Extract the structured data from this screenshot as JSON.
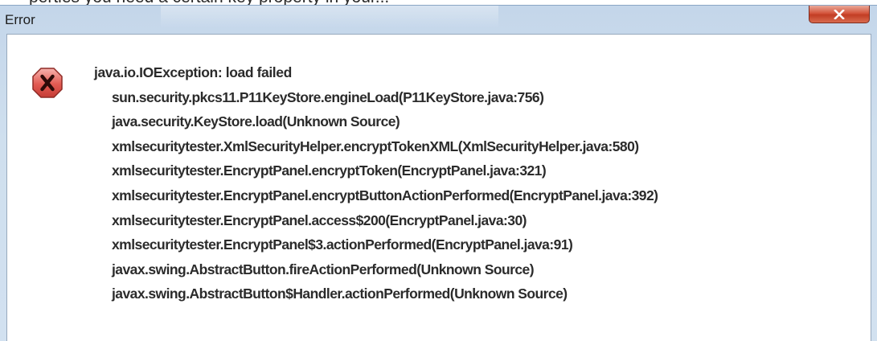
{
  "top_strip_text": "perties you need a certain key property in your...",
  "dialog": {
    "title": "Error",
    "close_label": "X",
    "icon": "error-x-icon",
    "exception_message": "java.io.IOException: load failed",
    "stack_frames": [
      "sun.security.pkcs11.P11KeyStore.engineLoad(P11KeyStore.java:756)",
      "java.security.KeyStore.load(Unknown Source)",
      "xmlsecuritytester.XmlSecurityHelper.encryptTokenXML(XmlSecurityHelper.java:580)",
      "xmlsecuritytester.EncryptPanel.encryptToken(EncryptPanel.java:321)",
      "xmlsecuritytester.EncryptPanel.encryptButtonActionPerformed(EncryptPanel.java:392)",
      "xmlsecuritytester.EncryptPanel.access$200(EncryptPanel.java:30)",
      "xmlsecuritytester.EncryptPanel$3.actionPerformed(EncryptPanel.java:91)",
      "javax.swing.AbstractButton.fireActionPerformed(Unknown Source)",
      "javax.swing.AbstractButton$Handler.actionPerformed(Unknown Source)"
    ]
  },
  "colors": {
    "icon_fill": "#e0554f",
    "icon_glyph": "#3a0d0b",
    "close_button": "#c9472d"
  }
}
